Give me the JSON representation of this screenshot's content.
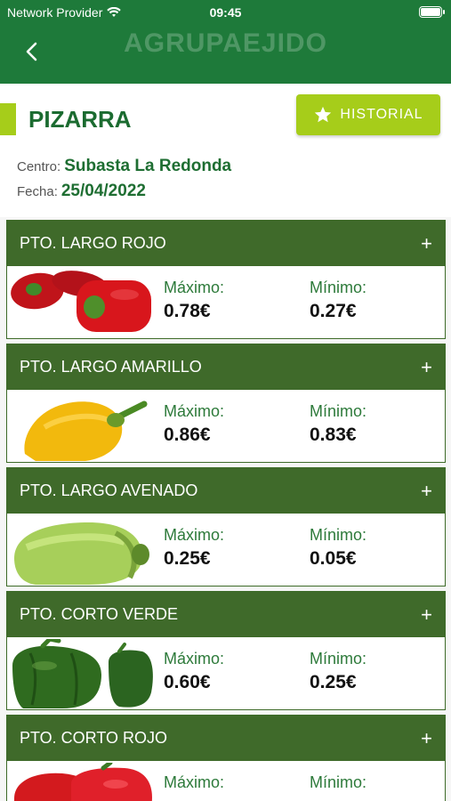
{
  "status": {
    "provider": "Network Provider",
    "time": "09:45"
  },
  "header": {
    "brand": "AGRUPAEJIDO"
  },
  "page": {
    "title": "PIZARRA",
    "history_label": "HISTORIAL",
    "centro_label": "Centro:",
    "centro_value": "Subasta La Redonda",
    "fecha_label": "Fecha:",
    "fecha_value": "25/04/2022"
  },
  "products": [
    {
      "name": "PTO. LARGO ROJO",
      "max_label": "Máximo:",
      "max": "0.78€",
      "min_label": "Mínimo:",
      "min": "0.27€",
      "image": "red-pepper-long"
    },
    {
      "name": "PTO. LARGO AMARILLO",
      "max_label": "Máximo:",
      "max": "0.86€",
      "min_label": "Mínimo:",
      "min": "0.83€",
      "image": "yellow-pepper-long"
    },
    {
      "name": "PTO. LARGO AVENADO",
      "max_label": "Máximo:",
      "max": "0.25€",
      "min_label": "Mínimo:",
      "min": "0.05€",
      "image": "light-green-pepper-long"
    },
    {
      "name": "PTO. CORTO VERDE",
      "max_label": "Máximo:",
      "max": "0.60€",
      "min_label": "Mínimo:",
      "min": "0.25€",
      "image": "green-pepper-short"
    },
    {
      "name": "PTO. CORTO ROJO",
      "max_label": "Máximo:",
      "max": "",
      "min_label": "Mínimo:",
      "min": "",
      "image": "red-pepper-short"
    }
  ],
  "colors": {
    "header_green": "#1e7a3a",
    "accent_lime": "#a6cd1a",
    "card_header": "#3f6a2a",
    "value_green": "#1e6e32"
  }
}
